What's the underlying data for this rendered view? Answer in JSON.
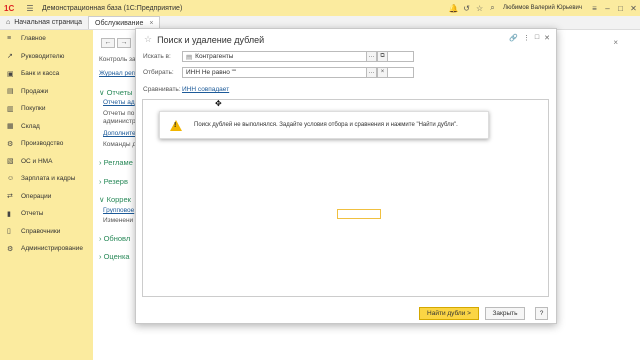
{
  "app": {
    "logo": "1С",
    "title": "Демонстрационная база (1С:Предприятие)",
    "user": "Любимов Валерий Юрьевич"
  },
  "tabs": [
    {
      "label": "Начальная страница"
    },
    {
      "label": "Обслуживание"
    }
  ],
  "sidebar": {
    "items": [
      {
        "label": "Главное",
        "icon": "menu-icon"
      },
      {
        "label": "Руководителю",
        "icon": "chart-icon"
      },
      {
        "label": "Банк и касса",
        "icon": "bank-icon"
      },
      {
        "label": "Продажи",
        "icon": "sales-icon"
      },
      {
        "label": "Покупки",
        "icon": "cart-icon"
      },
      {
        "label": "Склад",
        "icon": "warehouse-icon"
      },
      {
        "label": "Производство",
        "icon": "factory-icon"
      },
      {
        "label": "ОС и НМА",
        "icon": "assets-icon"
      },
      {
        "label": "Зарплата и кадры",
        "icon": "people-icon"
      },
      {
        "label": "Операции",
        "icon": "operations-icon"
      },
      {
        "label": "Отчеты",
        "icon": "reports-icon"
      },
      {
        "label": "Справочники",
        "icon": "book-icon"
      },
      {
        "label": "Администрирование",
        "icon": "gear-icon"
      }
    ]
  },
  "background": {
    "line1": "Контроль за",
    "journal_link": "Журнал реги",
    "group_reports": "Отчеты",
    "reports_link": "Отчеты ад",
    "reports_text1": "Отчеты по",
    "reports_text2": "администр",
    "extra_link": "Дополните",
    "commands_text": "Команды д",
    "group_regl": "Регламе",
    "group_reserve": "Резерв",
    "group_correct": "Коррек",
    "group_link": "Групповое",
    "change_text": "Изменени",
    "group_update": "Обновл",
    "group_eval": "Оценка"
  },
  "dialog": {
    "title": "Поиск и удаление дублей",
    "search_in_label": "Искать в:",
    "search_in_value": "Контрагенты",
    "filter_label": "Отбирать:",
    "filter_value": "ИНН Не равно \"\"",
    "compare_label": "Сравнивать:",
    "compare_value": "ИНН совпадает",
    "warning_text": "Поиск дублей не выполнялся.  Задайте условия отбора и сравнения и нажмите \"Найти дубли\".",
    "find_button": "Найти дубли >",
    "close_button": "Закрыть",
    "help_button": "?"
  }
}
